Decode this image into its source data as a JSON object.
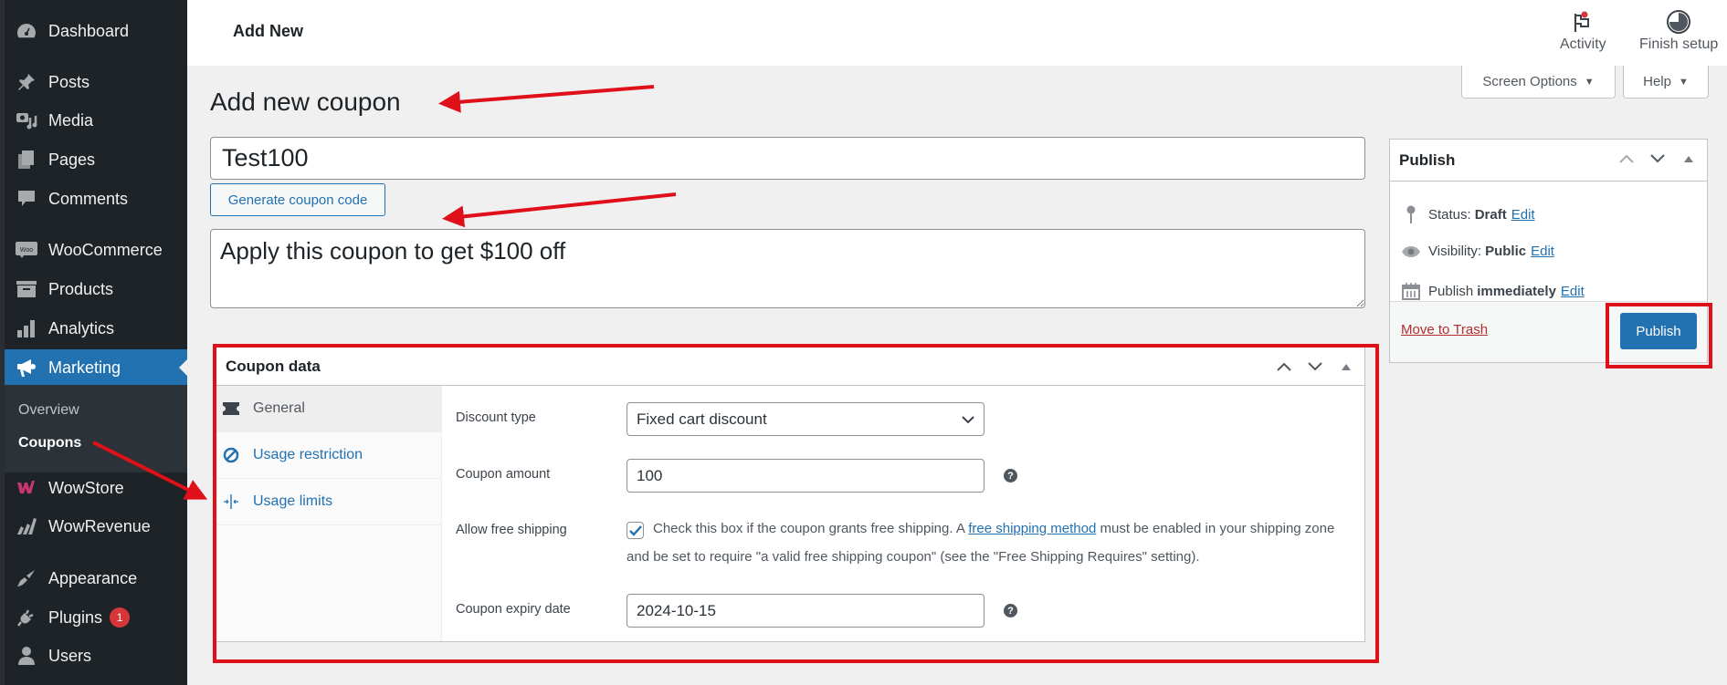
{
  "sidebar": {
    "items": [
      {
        "label": "Dashboard",
        "icon": "dashboard-icon"
      },
      {
        "label": "Posts",
        "icon": "pin-icon"
      },
      {
        "label": "Media",
        "icon": "media-icon"
      },
      {
        "label": "Pages",
        "icon": "pages-icon"
      },
      {
        "label": "Comments",
        "icon": "comment-icon"
      },
      {
        "label": "WooCommerce",
        "icon": "woo-icon"
      },
      {
        "label": "Products",
        "icon": "archive-icon"
      },
      {
        "label": "Analytics",
        "icon": "bar-chart-icon"
      },
      {
        "label": "Marketing",
        "icon": "megaphone-icon",
        "active": true
      },
      {
        "label": "WowStore",
        "icon": "wowstore-icon"
      },
      {
        "label": "WowRevenue",
        "icon": "wowrevenue-icon"
      },
      {
        "label": "Appearance",
        "icon": "brush-icon"
      },
      {
        "label": "Plugins",
        "icon": "plug-icon",
        "badge": "1"
      },
      {
        "label": "Users",
        "icon": "user-icon"
      }
    ],
    "submenu": [
      {
        "label": "Overview"
      },
      {
        "label": "Coupons",
        "current": true
      }
    ]
  },
  "header": {
    "breadcrumb": "Add New",
    "activity_label": "Activity",
    "finish_setup_label": "Finish setup",
    "screen_options_label": "Screen Options",
    "help_label": "Help"
  },
  "page": {
    "title": "Add new coupon",
    "coupon_code": "Test100",
    "generate_button": "Generate coupon code",
    "description": "Apply this coupon to get $100 off"
  },
  "coupon_data": {
    "title": "Coupon data",
    "tabs": [
      {
        "label": "General",
        "icon": "ticket-icon",
        "active": true
      },
      {
        "label": "Usage restriction",
        "icon": "block-icon"
      },
      {
        "label": "Usage limits",
        "icon": "limits-icon"
      }
    ],
    "fields": {
      "discount_type_label": "Discount type",
      "discount_type_value": "Fixed cart discount",
      "amount_label": "Coupon amount",
      "amount_value": "100",
      "free_shipping_label": "Allow free shipping",
      "free_shipping_checked": true,
      "free_shipping_text_1": "Check this box if the coupon grants free shipping. A ",
      "free_shipping_link": "free shipping method",
      "free_shipping_text_2": " must be enabled in your shipping zone and be set to require \"a valid free shipping coupon\" (see the \"Free Shipping Requires\" setting).",
      "expiry_label": "Coupon expiry date",
      "expiry_value": "2024-10-15"
    },
    "help_glyph": "?"
  },
  "publish": {
    "title": "Publish",
    "status_label": "Status:",
    "status_value": "Draft",
    "visibility_label": "Visibility:",
    "visibility_value": "Public",
    "schedule_label": "Publish",
    "schedule_value": "immediately",
    "edit_label": "Edit",
    "trash_label": "Move to Trash",
    "publish_button": "Publish"
  },
  "annotations": {
    "color": "#e0101a"
  }
}
